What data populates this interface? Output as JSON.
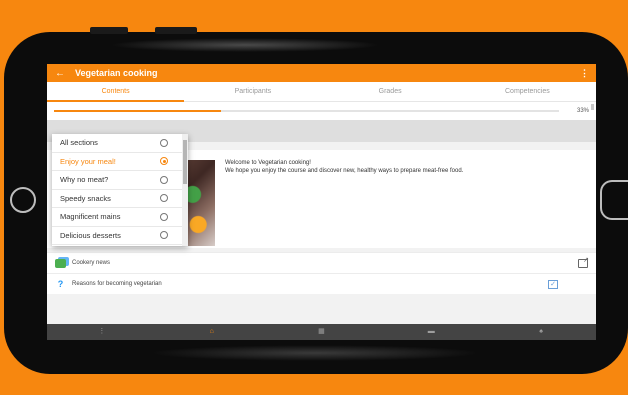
{
  "app": {
    "title": "Vegetarian cooking",
    "back_icon": "arrow-left-icon",
    "menu_icon": "more-vertical-icon"
  },
  "tabs": [
    {
      "label": "Contents",
      "active": true
    },
    {
      "label": "Participants",
      "active": false
    },
    {
      "label": "Grades",
      "active": false
    },
    {
      "label": "Competencies",
      "active": false
    }
  ],
  "progress": {
    "value": 0.33,
    "label": "33%"
  },
  "sections_menu": {
    "items": [
      {
        "label": "All sections",
        "selected": false
      },
      {
        "label": "Enjoy your meal!",
        "selected": true
      },
      {
        "label": "Why no meat?",
        "selected": false
      },
      {
        "label": "Speedy snacks",
        "selected": false
      },
      {
        "label": "Magnificent mains",
        "selected": false
      },
      {
        "label": "Delicious desserts",
        "selected": false
      }
    ]
  },
  "summary": {
    "line1": "Welcome to Vegetarian cooking!",
    "line2": "We hope you enjoy the course and discover  new, healthy ways to prepare meat-free food."
  },
  "modules": [
    {
      "label": "Cookery news",
      "icon": "forum-icon",
      "action_icon": "external-link-icon"
    },
    {
      "label": "Reasons for becoming vegetarian",
      "icon": "question-icon",
      "action_icon": "checkbox-checked-icon"
    }
  ],
  "bottom_nav": [
    {
      "icon": "more-vertical-icon",
      "active": false
    },
    {
      "icon": "home-icon",
      "active": true
    },
    {
      "icon": "calendar-icon",
      "active": false
    },
    {
      "icon": "courses-icon",
      "active": false
    },
    {
      "icon": "bell-icon",
      "active": false
    }
  ],
  "colors": {
    "accent": "#f7870f",
    "background": "#f7870f",
    "nav": "#444444"
  }
}
